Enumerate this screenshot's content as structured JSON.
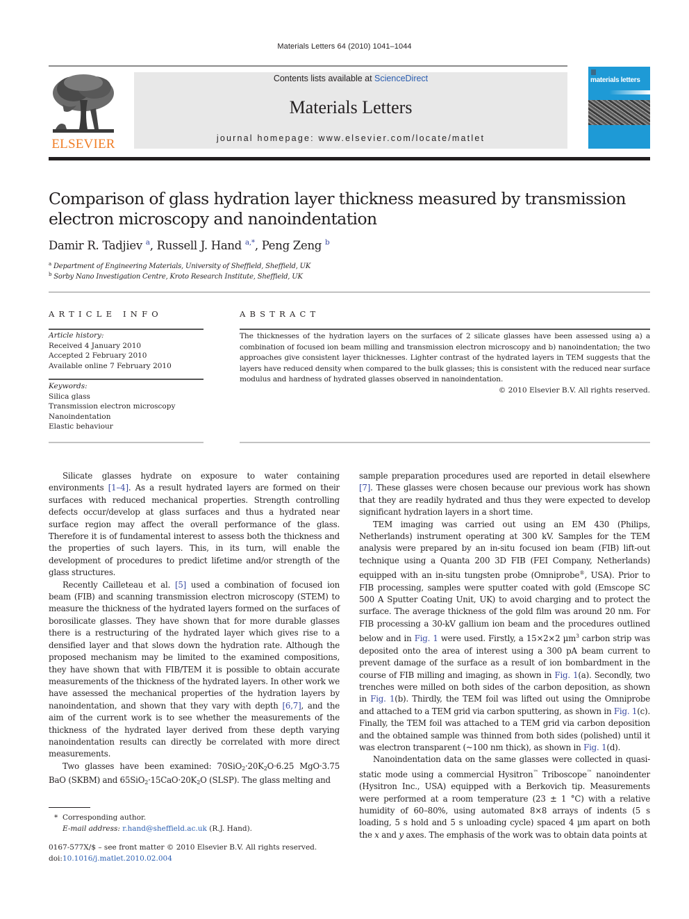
{
  "header": {
    "running_citation": "Materials Letters 64 (2010) 1041–1044",
    "publisher_logo_text": "ELSEVIER",
    "contents_prefix": "Contents lists available at ",
    "contents_link": "ScienceDirect",
    "journal_title": "Materials Letters",
    "homepage_label": "journal homepage: ",
    "homepage_url": "www.elsevier.com/locate/matlet",
    "cover_title": "materials letters",
    "colors": {
      "elsevier_orange": "#f07e26",
      "cover_blue": "#1e9ad6",
      "link_blue": "#2a5db0",
      "box_grey": "#e8e8e8"
    }
  },
  "article": {
    "title": "Comparison of glass hydration layer thickness measured by transmission electron microscopy and nanoindentation",
    "authors": [
      {
        "name": "Damir R. Tadjiev",
        "affil": "a"
      },
      {
        "name": "Russell J. Hand",
        "affil": "a,*"
      },
      {
        "name": "Peng Zeng",
        "affil": "b"
      }
    ],
    "affiliations": [
      {
        "key": "a",
        "text": "Department of Engineering Materials, University of Sheffield, Sheffield, UK"
      },
      {
        "key": "b",
        "text": "Sorby Nano Investigation Centre, Kroto Research Institute, Sheffield, UK"
      }
    ]
  },
  "article_info": {
    "heading": "ARTICLE INFO",
    "history_label": "Article history:",
    "history": [
      "Received 4 January 2010",
      "Accepted 2 February 2010",
      "Available online 7 February 2010"
    ],
    "keywords_label": "Keywords:",
    "keywords": [
      "Silica glass",
      "Transmission electron microscopy",
      "Nanoindentation",
      "Elastic behaviour"
    ]
  },
  "abstract": {
    "heading": "ABSTRACT",
    "text": "The thicknesses of the hydration layers on the surfaces of 2 silicate glasses have been assessed using a) a combination of focused ion beam milling and transmission electron microscopy and b) nanoindentation; the two approaches give consistent layer thicknesses. Lighter contrast of the hydrated layers in TEM suggests that the layers have reduced density when compared to the bulk glasses; this is consistent with the reduced near surface modulus and hardness of hydrated glasses observed in nanoindentation.",
    "copyright": "© 2010 Elsevier B.V. All rights reserved."
  },
  "body": {
    "left": {
      "p1": [
        "Silicate glasses hydrate on exposure to water containing environments ",
        "[1–4]",
        ". As a result hydrated layers are formed on their surfaces with reduced mechanical properties. Strength controlling defects occur/develop at glass surfaces and thus a hydrated near surface region may affect the overall performance of the glass. Therefore it is of fundamental interest to assess both the thickness and the properties of such layers. This, in its turn, will enable the development of procedures to predict lifetime and/or strength of the glass structures."
      ],
      "p2": [
        "Recently Cailleteau et al. ",
        "[5]",
        " used a combination of focused ion beam (FIB) and scanning transmission electron microscopy (STEM) to measure the thickness of the hydrated layers formed on the surfaces of borosilicate glasses. They have shown that for more durable glasses there is a restructuring of the hydrated layer which gives rise to a densified layer and that slows down the hydration rate. Although the proposed mechanism may be limited to the examined compositions, they have shown that with FIB/TEM it is possible to obtain accurate measurements of the thickness of the hydrated layers. In other work we have assessed the mechanical properties of the hydration layers by nanoindentation, and shown that they vary with depth ",
        "[6,7]",
        ", and the aim of the current work is to see whether the measurements of the thickness of the hydrated layer derived from these depth varying nanoindentation results can directly be correlated with more direct measurements."
      ],
      "p3": {
        "intro": "Two glasses have been examined: ",
        "glass1": [
          "70SiO",
          "2",
          "·20K",
          "2",
          "O·6.25 MgO·3.75 BaO (SKBM)"
        ],
        "and": " and ",
        "glass2": [
          "65SiO",
          "2",
          "·15CaO·20K",
          "2",
          "O (SLSP)"
        ],
        "tail": ". The glass melting and"
      }
    },
    "right": {
      "p1": [
        "sample preparation procedures used are reported in detail elsewhere ",
        "[7]",
        ". These glasses were chosen because our previous work has shown that they are readily hydrated and thus they were expected to develop significant hydration layers in a short time."
      ],
      "p2": {
        "a": "TEM imaging was carried out using an EM 430 (Philips, Netherlands) instrument operating at 300 kV. Samples for the TEM analysis were prepared by an in-situ focused ion beam (FIB) lift-out technique using a Quanta 200 3D FIB (FEI Company, Netherlands) equipped with an in-situ tungsten probe (Omniprobe",
        "reg": "®",
        "b": ", USA). Prior to FIB processing, samples were sputter coated with gold (Emscope SC 500 A Sputter Coating Unit, UK) to avoid charging and to protect the surface. The average thickness of the gold film was around 20 nm. For FIB processing a 30-kV gallium ion beam and the procedures outlined below and in ",
        "fig1": "Fig. 1",
        "c": " were used. Firstly, a 15×2×2 µm",
        "cube": "3",
        "d": " carbon strip was deposited onto the area of interest using a 300 pA beam current to prevent damage of the surface as a result of ion bombardment in the course of FIB milling and imaging, as shown in ",
        "fig1a": "Fig. 1",
        "e": "(a). Secondly, two trenches were milled on both sides of the carbon deposition, as shown in ",
        "fig1b": "Fig. 1",
        "f": "(b). Thirdly, the TEM foil was lifted out using the Omniprobe and attached to a TEM grid via carbon sputtering, as shown in ",
        "fig1c": "Fig. 1",
        "g": "(c). Finally, the TEM foil was attached to a TEM grid via carbon deposition and the obtained sample was thinned from both sides (polished) until it was electron transparent (~100 nm thick), as shown in ",
        "fig1d": "Fig. 1",
        "h": "(d)."
      },
      "p3": {
        "a": "Nanoindentation data on the same glasses were collected in quasi-static mode using a commercial Hysitron",
        "tm1": "™",
        "b": " Triboscope",
        "tm2": "™",
        "c": " nanoindenter (Hysitron Inc., USA) equipped with a Berkovich tip. Measurements were performed at a room temperature (23 ± 1 °C) with a relative humidity of 60–80%, using automated 8×8 arrays of indents (5 s loading, 5 s hold and 5 s unloading cycle) spaced 4 µm apart on both the ",
        "x": "x",
        "and": " and ",
        "y": "y",
        "d": " axes. The emphasis of the work was to obtain data points at"
      }
    }
  },
  "footnotes": {
    "star": "*",
    "corresponding": "Corresponding author.",
    "email_label": "E-mail address:",
    "email": "r.hand@sheffield.ac.uk",
    "email_suffix": " (R.J. Hand).",
    "issn": "0167-577X/$ – see front matter © 2010 Elsevier B.V. All rights reserved.",
    "doi_label": "doi:",
    "doi": "10.1016/j.matlet.2010.02.004"
  }
}
